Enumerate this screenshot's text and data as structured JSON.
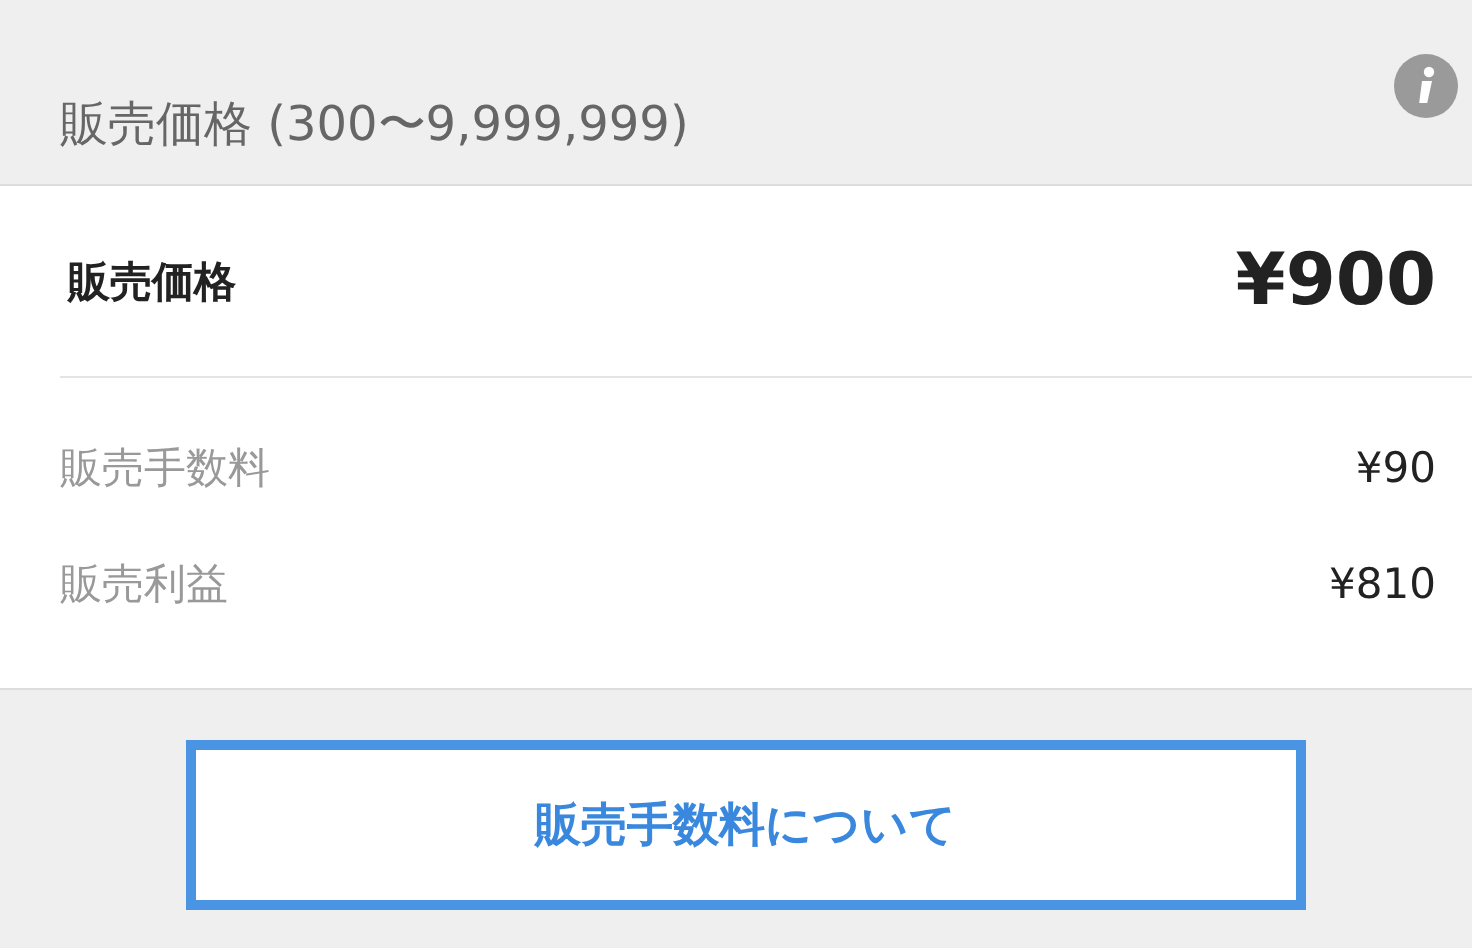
{
  "header": {
    "title": "販売価格 (300〜9,999,999)"
  },
  "price": {
    "label": "販売価格",
    "value": "¥900"
  },
  "details": [
    {
      "label": "販売手数料",
      "value": "¥90"
    },
    {
      "label": "販売利益",
      "value": "¥810"
    }
  ],
  "button": {
    "label": "販売手数料について"
  }
}
